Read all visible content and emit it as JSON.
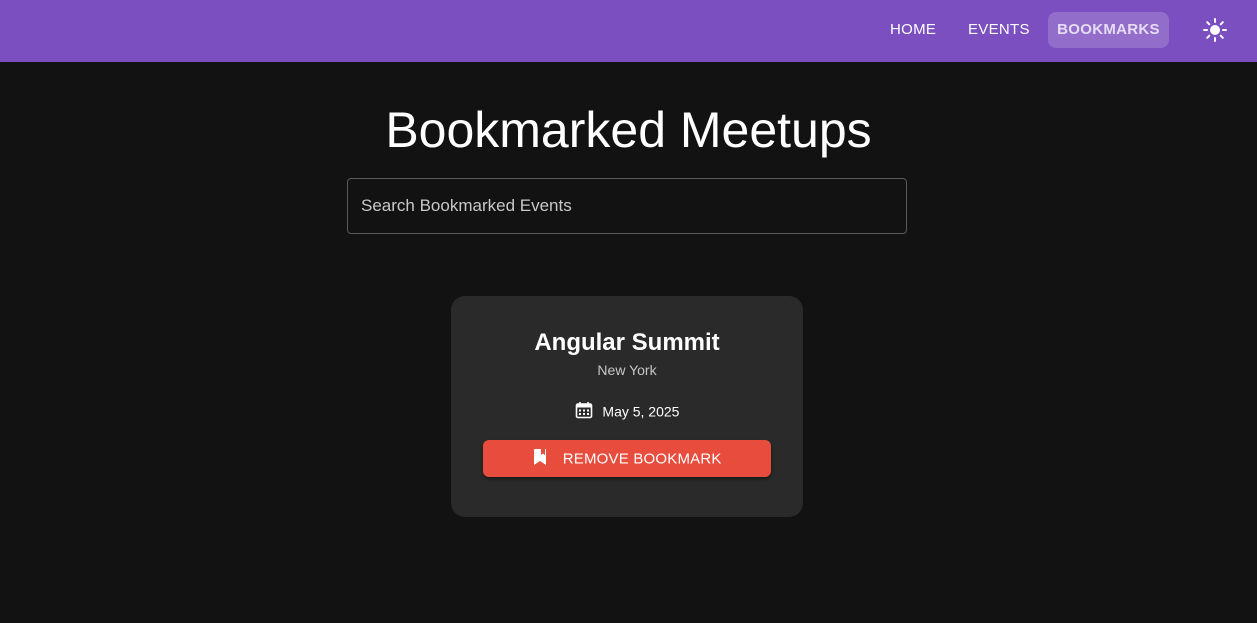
{
  "navbar": {
    "background_color": "#7b4fbf",
    "links": [
      {
        "label": "HOME"
      },
      {
        "label": "EVENTS"
      },
      {
        "label": "BOOKMARKS",
        "active": true
      }
    ],
    "theme_toggle_icon": "sun-icon"
  },
  "main": {
    "title": "Bookmarked Meetups",
    "search": {
      "placeholder": "Search Bookmarked Events",
      "value": ""
    },
    "events": [
      {
        "title": "Angular Summit",
        "location": "New York",
        "date": "May 5, 2025",
        "date_icon": "calendar-icon",
        "action_label": "REMOVE BOOKMARK",
        "action_icon": "bookmark-remove-icon",
        "action_color": "#e84c3d"
      }
    ]
  }
}
